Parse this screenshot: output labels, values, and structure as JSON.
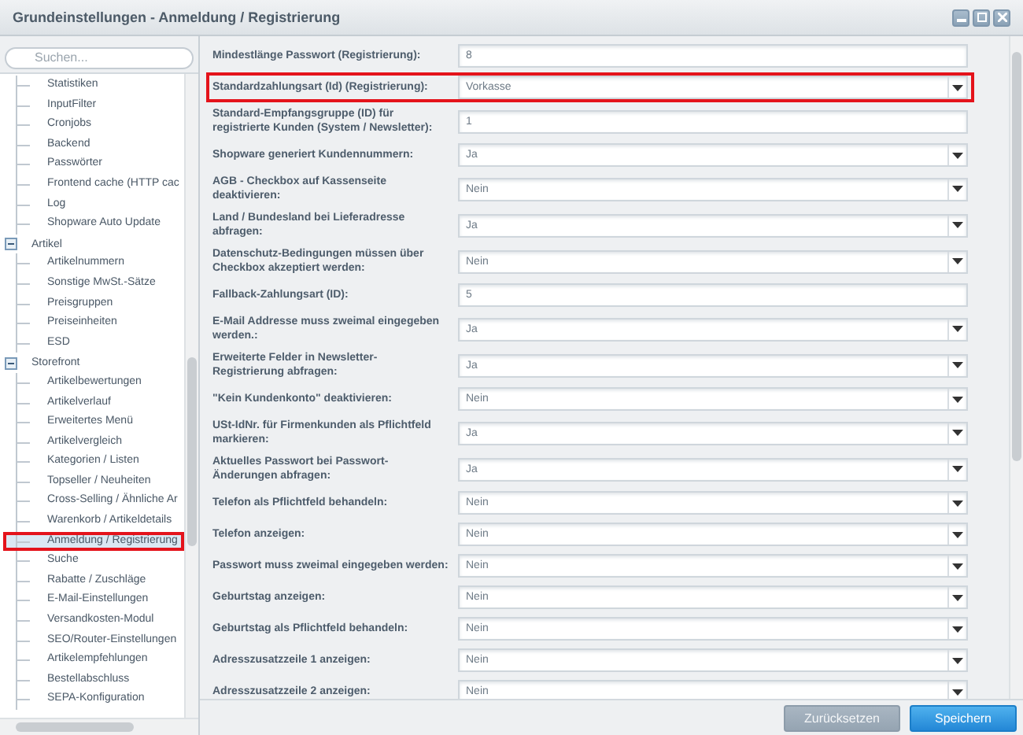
{
  "window": {
    "title": "Grundeinstellungen - Anmeldung / Registrierung"
  },
  "sidebar": {
    "search": {
      "placeholder": "Suchen..."
    },
    "tree": [
      {
        "children": [
          {
            "label": "Statistiken",
            "selected": false
          },
          {
            "label": "InputFilter",
            "selected": false
          },
          {
            "label": "Cronjobs",
            "selected": false
          },
          {
            "label": "Backend",
            "selected": false
          },
          {
            "label": "Passwörter",
            "selected": false
          },
          {
            "label": "Frontend cache (HTTP cac",
            "selected": false
          },
          {
            "label": "Log",
            "selected": false
          },
          {
            "label": "Shopware Auto Update",
            "selected": false
          }
        ]
      },
      {
        "label": "Artikel",
        "expanded": true,
        "children": [
          {
            "label": "Artikelnummern",
            "selected": false
          },
          {
            "label": "Sonstige MwSt.-Sätze",
            "selected": false
          },
          {
            "label": "Preisgruppen",
            "selected": false
          },
          {
            "label": "Preiseinheiten",
            "selected": false
          },
          {
            "label": "ESD",
            "selected": false
          }
        ]
      },
      {
        "label": "Storefront",
        "expanded": true,
        "children": [
          {
            "label": "Artikelbewertungen",
            "selected": false
          },
          {
            "label": "Artikelverlauf",
            "selected": false
          },
          {
            "label": "Erweitertes Menü",
            "selected": false
          },
          {
            "label": "Artikelvergleich",
            "selected": false
          },
          {
            "label": "Kategorien / Listen",
            "selected": false
          },
          {
            "label": "Topseller / Neuheiten",
            "selected": false
          },
          {
            "label": "Cross-Selling / Ähnliche Ar",
            "selected": false
          },
          {
            "label": "Warenkorb / Artikeldetails",
            "selected": false
          },
          {
            "label": "Anmeldung / Registrierung",
            "selected": true,
            "highlighted": true
          },
          {
            "label": "Suche",
            "selected": false
          },
          {
            "label": "Rabatte / Zuschläge",
            "selected": false
          },
          {
            "label": "E-Mail-Einstellungen",
            "selected": false
          },
          {
            "label": "Versandkosten-Modul",
            "selected": false
          },
          {
            "label": "SEO/Router-Einstellungen",
            "selected": false
          },
          {
            "label": "Artikelempfehlungen",
            "selected": false
          },
          {
            "label": "Bestellabschluss",
            "selected": false
          },
          {
            "label": "SEPA-Konfiguration",
            "selected": false
          }
        ]
      }
    ]
  },
  "form": {
    "fields": [
      {
        "label": "Mindestlänge Passwort (Registrierung):",
        "kind": "text",
        "value": "8"
      },
      {
        "label": "Standardzahlungsart (Id) (Registrierung):",
        "kind": "select",
        "value": "Vorkasse",
        "highlighted": true
      },
      {
        "label": "Standard-Empfangsgruppe (ID) für registrierte Kunden (System / Newsletter):",
        "kind": "text",
        "value": "1"
      },
      {
        "label": "Shopware generiert Kundennummern:",
        "kind": "select",
        "value": "Ja"
      },
      {
        "label": "AGB - Checkbox auf Kassenseite deaktivieren:",
        "kind": "select",
        "value": "Nein"
      },
      {
        "label": "Land / Bundesland bei Lieferadresse abfragen:",
        "kind": "select",
        "value": "Ja"
      },
      {
        "label": "Datenschutz-Bedingungen müssen über Checkbox akzeptiert werden:",
        "kind": "select",
        "value": "Nein"
      },
      {
        "label": "Fallback-Zahlungsart (ID):",
        "kind": "text",
        "value": "5"
      },
      {
        "label": "E-Mail Addresse muss zweimal eingegeben werden.:",
        "kind": "select",
        "value": "Ja"
      },
      {
        "label": "Erweiterte Felder in Newsletter-Registrierung abfragen:",
        "kind": "select",
        "value": "Ja"
      },
      {
        "label": "\"Kein Kundenkonto\" deaktivieren:",
        "kind": "select",
        "value": "Nein"
      },
      {
        "label": "USt-IdNr. für Firmenkunden als Pflichtfeld markieren:",
        "kind": "select",
        "value": "Ja"
      },
      {
        "label": "Aktuelles Passwort bei Passwort-Änderungen abfragen:",
        "kind": "select",
        "value": "Ja"
      },
      {
        "label": "Telefon als Pflichtfeld behandeln:",
        "kind": "select",
        "value": "Nein"
      },
      {
        "label": "Telefon anzeigen:",
        "kind": "select",
        "value": "Nein"
      },
      {
        "label": "Passwort muss zweimal eingegeben werden:",
        "kind": "select",
        "value": "Nein"
      },
      {
        "label": "Geburtstag anzeigen:",
        "kind": "select",
        "value": "Nein"
      },
      {
        "label": "Geburtstag als Pflichtfeld behandeln:",
        "kind": "select",
        "value": "Nein"
      },
      {
        "label": "Adresszusatzzeile 1 anzeigen:",
        "kind": "select",
        "value": "Nein"
      },
      {
        "label": "Adresszusatzzeile 2 anzeigen:",
        "kind": "select",
        "value": "Nein"
      }
    ]
  },
  "buttons": [
    {
      "label": "Zurücksetzen",
      "kind": "secondary",
      "disabled": true
    },
    {
      "label": "Speichern",
      "kind": "primary",
      "disabled": false
    }
  ]
}
